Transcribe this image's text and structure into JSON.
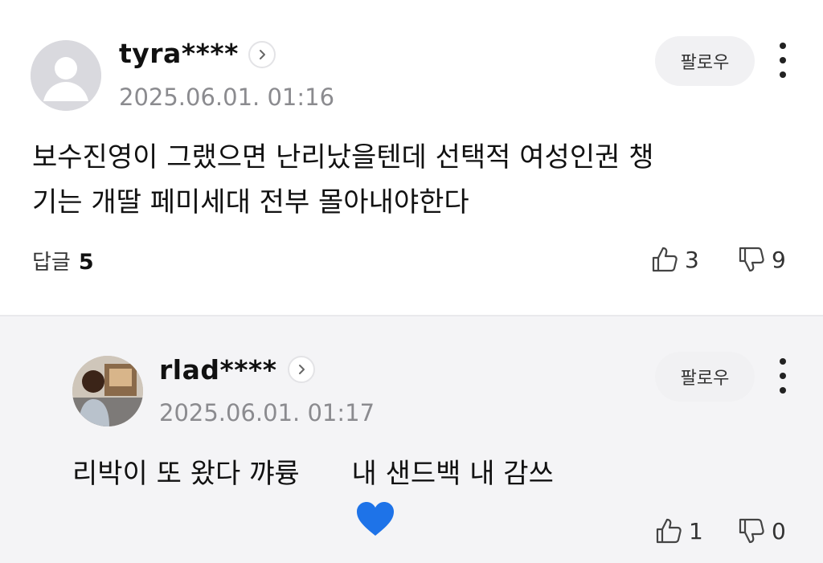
{
  "comments": [
    {
      "username": "tyra****",
      "timestamp": "2025.06.01. 01:16",
      "follow_label": "팔로우",
      "text_line1": "보수진영이 그랬으면 난리났을텐데 선택적 여성인권 챙",
      "text_line2": "기는 개딸 페미세대 전부 몰아내야한다",
      "replies_label": "답글",
      "replies_count": "5",
      "likes": "3",
      "dislikes": "9",
      "avatar": "default-profile-icon"
    },
    {
      "username": "rlad****",
      "timestamp": "2025.06.01. 01:17",
      "follow_label": "팔로우",
      "text_before_emoji": "리박이 또 왔다 꺄륭",
      "emoji": "blue-heart-emoji",
      "text_after_emoji": " 내 샌드백 내 감쓰",
      "likes": "1",
      "dislikes": "0",
      "avatar": "profile-photo"
    }
  ],
  "colors": {
    "reply_background": "#f4f4f6",
    "timestamp": "#8b8b8f",
    "heart": "#1e73e8"
  }
}
